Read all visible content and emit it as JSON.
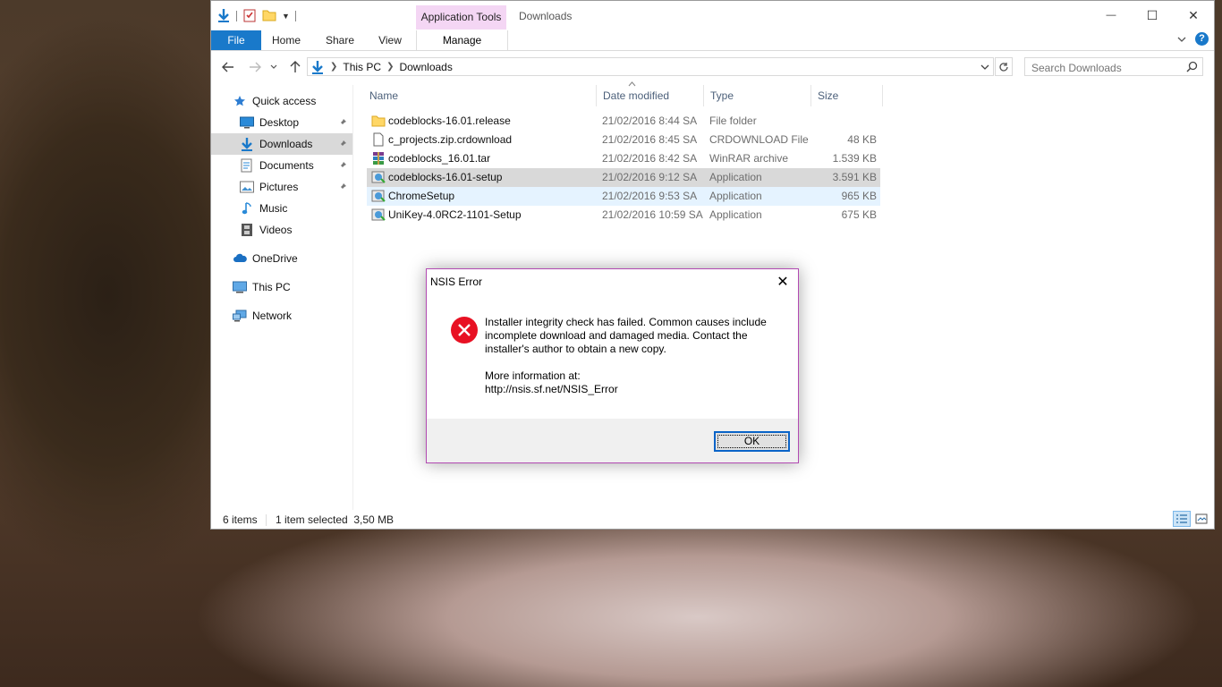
{
  "window": {
    "title": "Downloads",
    "context_tab": "Application Tools",
    "caption": {
      "minimize": "—",
      "maximize": "☐",
      "close": "✕"
    }
  },
  "ribbon": {
    "tabs": [
      "File",
      "Home",
      "Share",
      "View"
    ],
    "manage": "Manage",
    "help": "?"
  },
  "address": {
    "crumbs": [
      "This PC",
      "Downloads"
    ],
    "search_placeholder": "Search Downloads"
  },
  "nav": {
    "items": [
      {
        "label": "Quick access",
        "icon": "star-icon"
      },
      {
        "label": "Desktop",
        "icon": "desktop-icon",
        "pinned": true
      },
      {
        "label": "Downloads",
        "icon": "download-arrow-icon",
        "pinned": true,
        "selected": true
      },
      {
        "label": "Documents",
        "icon": "documents-icon",
        "pinned": true
      },
      {
        "label": "Pictures",
        "icon": "pictures-icon",
        "pinned": true
      },
      {
        "label": "Music",
        "icon": "music-icon"
      },
      {
        "label": "Videos",
        "icon": "videos-icon"
      },
      {
        "label": "OneDrive",
        "icon": "cloud-icon"
      },
      {
        "label": "This PC",
        "icon": "computer-icon"
      },
      {
        "label": "Network",
        "icon": "network-icon"
      }
    ]
  },
  "files": {
    "columns": [
      "Name",
      "Date modified",
      "Type",
      "Size"
    ],
    "rows": [
      {
        "name": "codeblocks-16.01.release",
        "date": "21/02/2016 8:44 SA",
        "type": "File folder",
        "size": "",
        "icon": "folder-icon"
      },
      {
        "name": "c_projects.zip.crdownload",
        "date": "21/02/2016 8:45 SA",
        "type": "CRDOWNLOAD File",
        "size": "48 KB",
        "icon": "blank-file-icon"
      },
      {
        "name": "codeblocks_16.01.tar",
        "date": "21/02/2016 8:42 SA",
        "type": "WinRAR archive",
        "size": "1.539 KB",
        "icon": "winrar-icon"
      },
      {
        "name": "codeblocks-16.01-setup",
        "date": "21/02/2016 9:12 SA",
        "type": "Application",
        "size": "3.591 KB",
        "icon": "installer-icon",
        "state": "selected"
      },
      {
        "name": "ChromeSetup",
        "date": "21/02/2016 9:53 SA",
        "type": "Application",
        "size": "965 KB",
        "icon": "installer-icon",
        "state": "hover"
      },
      {
        "name": "UniKey-4.0RC2-1101-Setup",
        "date": "21/02/2016 10:59 SA",
        "type": "Application",
        "size": "675 KB",
        "icon": "installer-icon"
      }
    ]
  },
  "status": {
    "count": "6 items",
    "selection": "1 item selected  3,50 MB"
  },
  "dialog": {
    "title": "NSIS Error",
    "close": "✕",
    "message_lines": [
      "Installer integrity check has failed. Common causes include",
      "incomplete download and damaged media. Contact the",
      "installer's author to obtain a new copy."
    ],
    "info_label": "More information at:",
    "info_url": "http://nsis.sf.net/NSIS_Error",
    "ok": "OK"
  }
}
